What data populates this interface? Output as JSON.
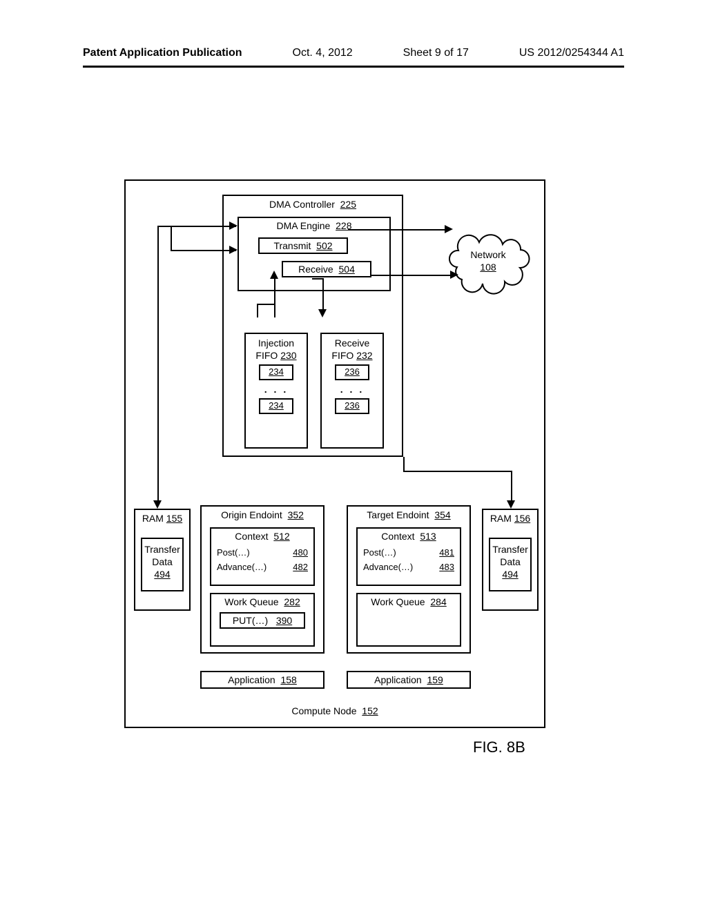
{
  "header": {
    "publication": "Patent Application Publication",
    "date": "Oct. 4, 2012",
    "sheet": "Sheet 9 of 17",
    "docnum": "US 2012/0254344 A1"
  },
  "figure_caption": "FIG. 8B",
  "compute_node": {
    "label": "Compute Node",
    "ref": "152"
  },
  "dma_controller": {
    "label": "DMA Controller",
    "ref": "225"
  },
  "dma_engine": {
    "label": "DMA Engine",
    "ref": "228"
  },
  "transmit": {
    "label": "Transmit",
    "ref": "502"
  },
  "receive": {
    "label": "Receive",
    "ref": "504"
  },
  "network": {
    "label": "Network",
    "ref": "108"
  },
  "injection_fifo": {
    "label1": "Injection",
    "label2": "FIFO",
    "ref": "230",
    "slot": "234"
  },
  "receive_fifo": {
    "label1": "Receive",
    "label2": "FIFO",
    "ref": "232",
    "slot": "236"
  },
  "ram_left": {
    "label": "RAM",
    "ref": "155"
  },
  "ram_right": {
    "label": "RAM",
    "ref": "156"
  },
  "transfer_left": {
    "l1": "Transfer",
    "l2": "Data",
    "ref": "494"
  },
  "transfer_right": {
    "l1": "Transfer",
    "l2": "Data",
    "ref": "494"
  },
  "origin": {
    "label": "Origin Endoint",
    "ref": "352"
  },
  "target": {
    "label": "Target Endoint",
    "ref": "354"
  },
  "context_left": {
    "label": "Context",
    "ref": "512"
  },
  "context_right": {
    "label": "Context",
    "ref": "513"
  },
  "post_left": {
    "label": "Post(…)",
    "ref": "480"
  },
  "post_right": {
    "label": "Post(…)",
    "ref": "481"
  },
  "advance_left": {
    "label": "Advance(…)",
    "ref": "482"
  },
  "advance_right": {
    "label": "Advance(…)",
    "ref": "483"
  },
  "work_queue_left": {
    "label": "Work Queue",
    "ref": "282"
  },
  "work_queue_right": {
    "label": "Work Queue",
    "ref": "284"
  },
  "put": {
    "label": "PUT(…)",
    "ref": "390"
  },
  "app_left": {
    "label": "Application",
    "ref": "158"
  },
  "app_right": {
    "label": "Application",
    "ref": "159"
  }
}
